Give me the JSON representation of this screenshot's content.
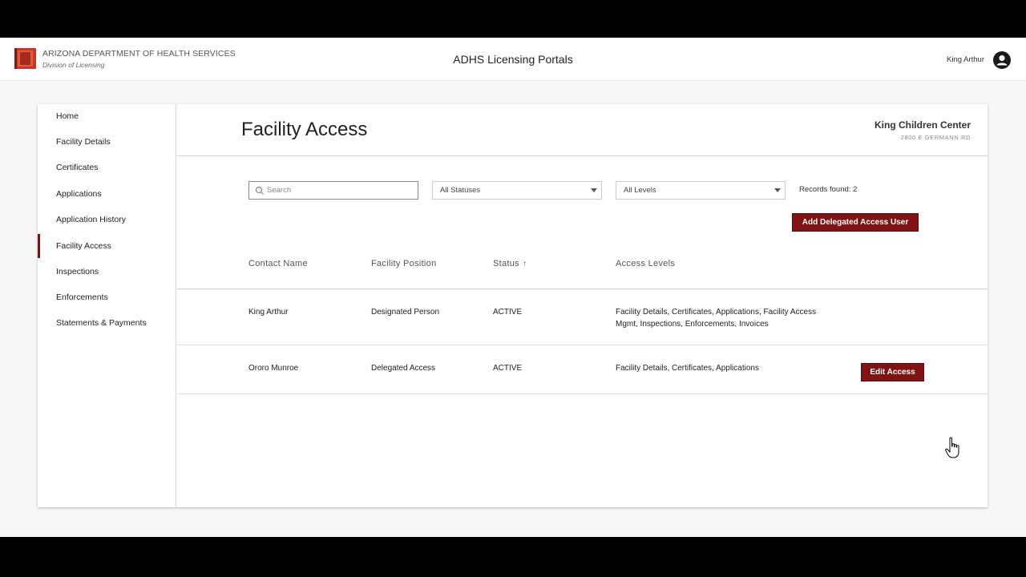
{
  "header": {
    "org_name": "ARIZONA DEPARTMENT OF HEALTH SERVICES",
    "org_division": "Division of Licensing",
    "portal_title": "ADHS Licensing Portals",
    "user_name": "King Arthur",
    "avatar_icon": "user-avatar-icon"
  },
  "sidebar": {
    "items": [
      {
        "label": "Home"
      },
      {
        "label": "Facility Details"
      },
      {
        "label": "Certificates"
      },
      {
        "label": "Applications"
      },
      {
        "label": "Application History"
      },
      {
        "label": "Facility Access"
      },
      {
        "label": "Inspections"
      },
      {
        "label": "Enforcements"
      },
      {
        "label": "Statements & Payments"
      }
    ],
    "active": "Facility Access"
  },
  "main": {
    "title": "Facility Access",
    "facility_name": "King Children Center",
    "facility_address": "2800 E GERMANN RD",
    "search_placeholder": "Search",
    "status_filter": "All Statuses",
    "level_filter": "All Levels",
    "records_found": "Records found: 2",
    "add_button": "Add Delegated Access User",
    "columns": [
      "Contact Name",
      "Facility Position",
      "Status",
      "Access Levels"
    ],
    "sort_indicator": "↑",
    "rows": [
      {
        "contact": "King Arthur",
        "position": "Designated Person",
        "status": "ACTIVE",
        "access_line1": "Facility Details, Certificates, Applications, Facility Access",
        "access_line2": "Mgmt, Inspections, Enforcements, Invoices"
      },
      {
        "contact": "Ororo Munroe",
        "position": "Delegated Access",
        "status": "ACTIVE",
        "access_line1": "Facility Details, Certificates, Applications",
        "edit_button": "Edit Access"
      }
    ]
  },
  "colors": {
    "accent": "#7f1212",
    "logo_red": "#c0392b"
  }
}
